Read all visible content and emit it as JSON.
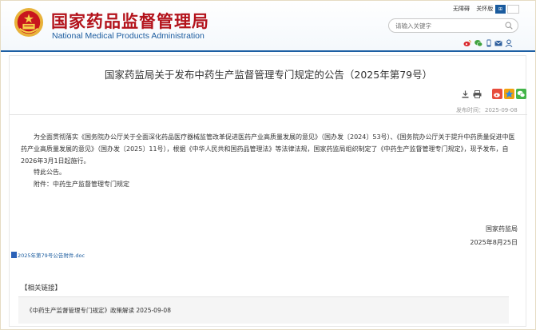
{
  "header": {
    "title_cn": "国家药品监督管理局",
    "title_en": "National Medical Products Administration",
    "top_links": [
      "无障碍",
      "关怀版"
    ],
    "search": {
      "placeholder": "请输入关键字",
      "value": ""
    }
  },
  "article": {
    "title": "国家药监局关于发布中药生产监督管理专门规定的公告（2025年第79号）",
    "publish_label": "发布时间：",
    "publish_date": "2025-09-08",
    "paragraph1": "为全面贯彻落实《国务院办公厅关于全面深化药品医疗器械监管改革促进医药产业高质量发展的意见》（国办发〔2024〕53号）、《国务院办公厅关于提升中药质量促进中医药产业高质量发展的意见》（国办发〔2025〕11号），根据《中华人民共和国药品管理法》等法律法规，国家药监局组织制定了《中药生产监督管理专门规定》，现予发布，自2026年3月1日起施行。",
    "paragraph2": "特此公告。",
    "attachment_line": "附件：中药生产监督管理专门规定",
    "signer": "国家药监局",
    "sign_date": "2025年8月25日",
    "attachment_file": "2025年第79号公告附件.doc"
  },
  "related": {
    "label": "【相关链接】",
    "links": [
      {
        "text": "《中药生产监督管理专门规定》政策解读 2025-09-08"
      }
    ]
  },
  "colors": {
    "brand_red": "#b3121b",
    "brand_blue": "#1d5fa3"
  },
  "icons": [
    "emblem-icon",
    "search-icon",
    "weibo-icon",
    "wechat-icon",
    "mobile-icon",
    "mail-icon",
    "user-icon",
    "download-icon",
    "print-icon",
    "share-weibo-icon",
    "share-qzone-icon",
    "share-wechat-icon",
    "doc-icon"
  ]
}
